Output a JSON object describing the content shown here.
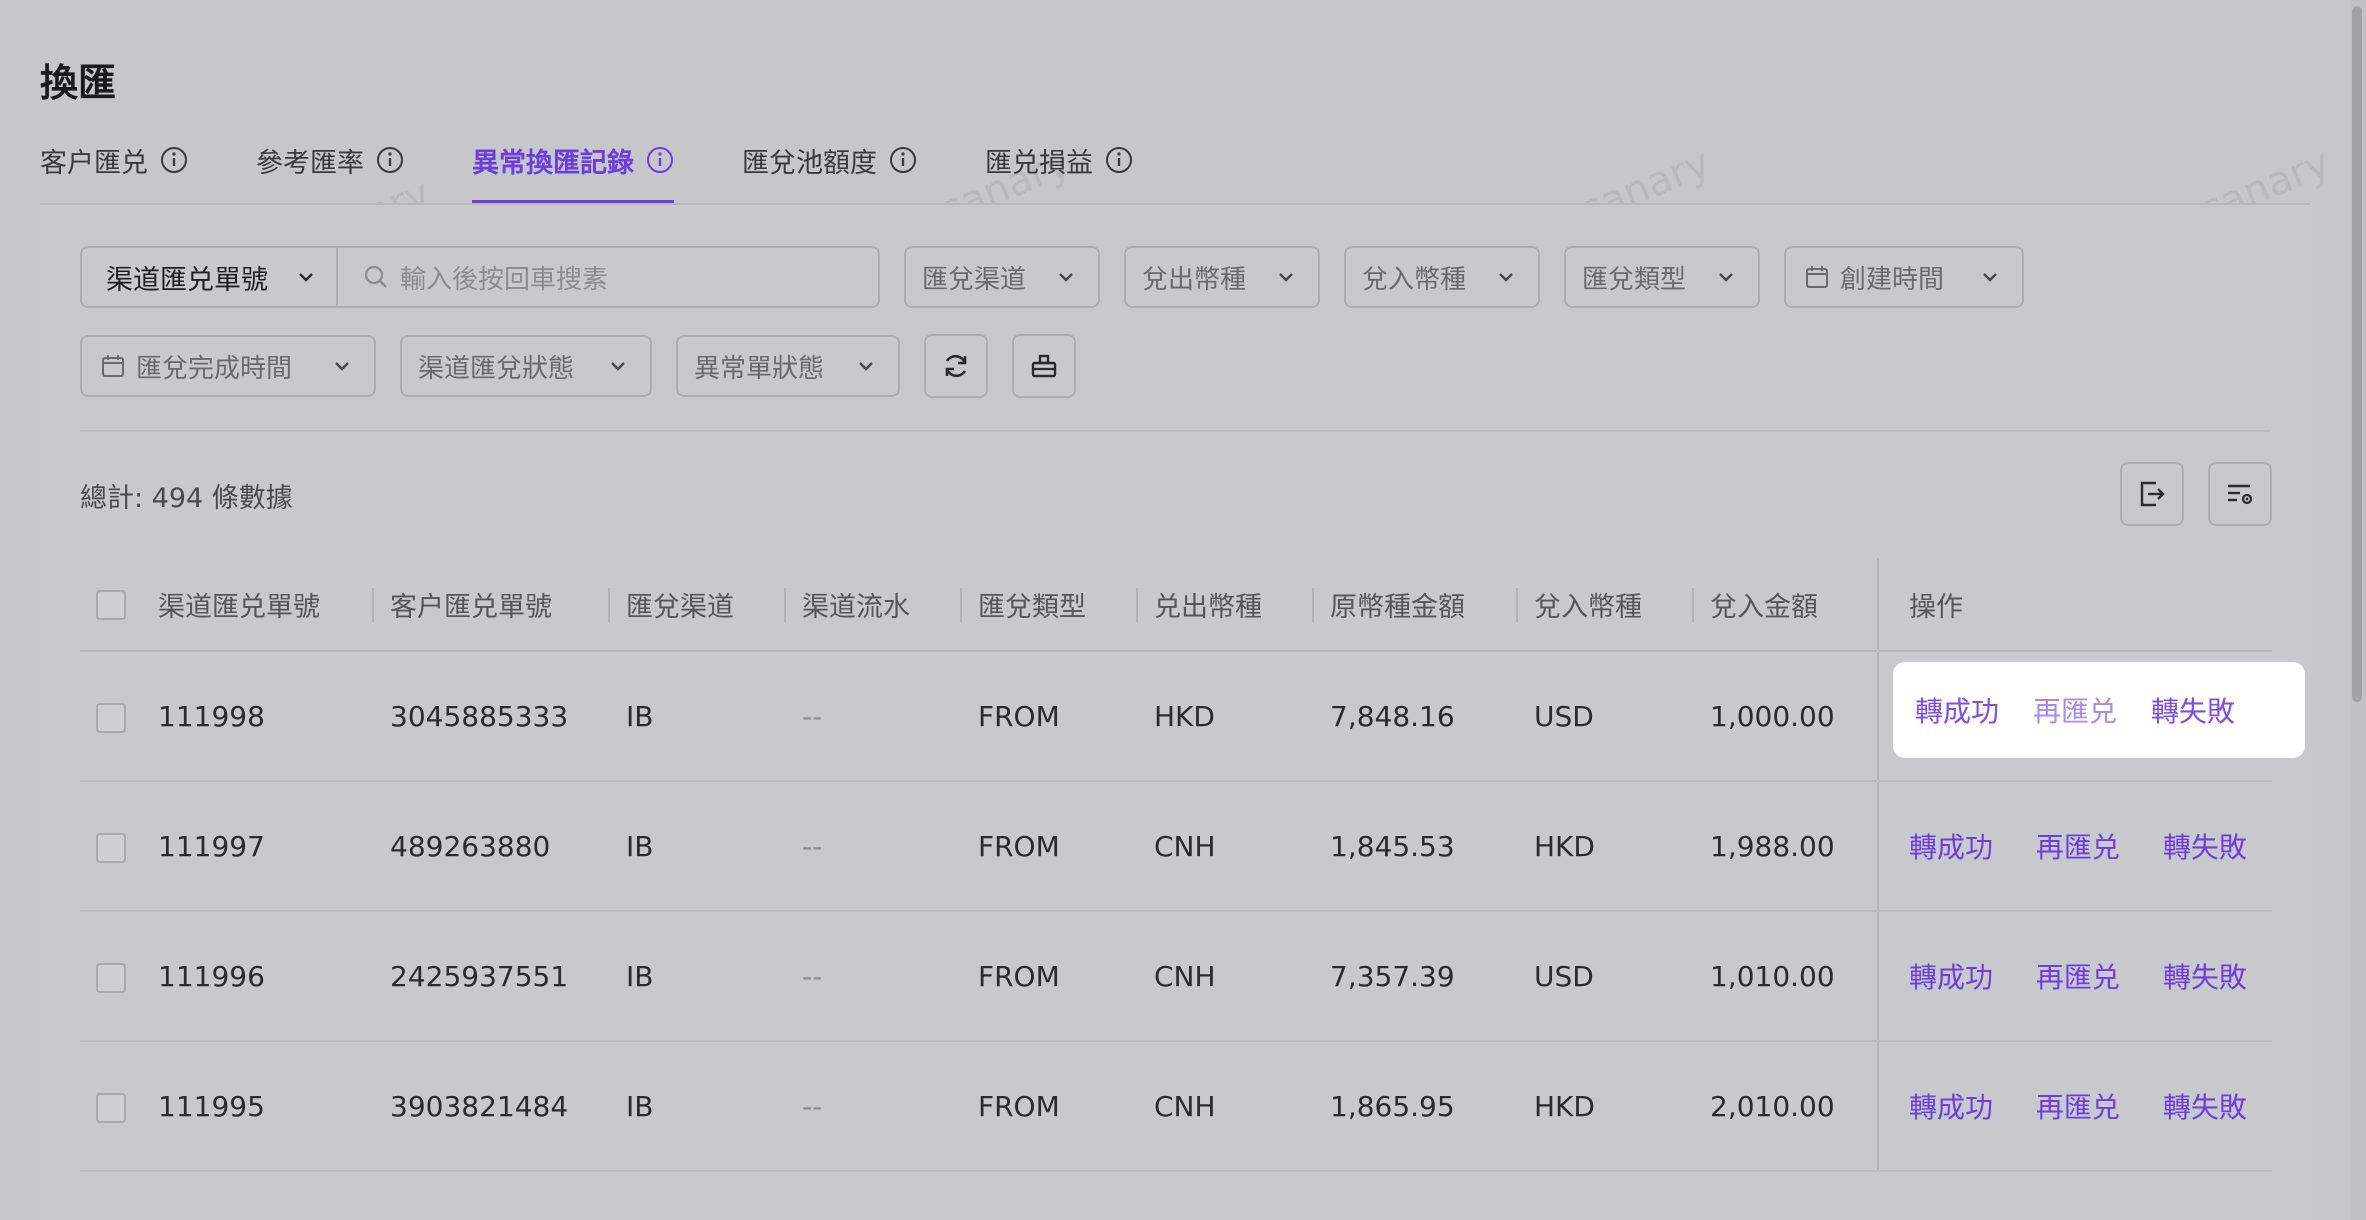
{
  "page": {
    "title": "換匯"
  },
  "tabs": [
    {
      "label": "客户匯兑",
      "active": false
    },
    {
      "label": "參考匯率",
      "active": false
    },
    {
      "label": "異常換匯記錄",
      "active": true
    },
    {
      "label": "匯兌池額度",
      "active": false
    },
    {
      "label": "匯兑損益",
      "active": false
    }
  ],
  "filters": {
    "search_field": "渠道匯兑單號",
    "search_placeholder": "輸入後按回車搜素",
    "channel": "匯兌渠道",
    "out_currency": "兌出幣種",
    "in_currency": "兌入幣種",
    "exchange_type": "匯兌類型",
    "created_time": "創建時間",
    "completed_time": "匯兌完成時間",
    "channel_status": "渠道匯兌狀態",
    "exception_status": "異常單狀態"
  },
  "summary": {
    "total": "總計: 494 條數據"
  },
  "table": {
    "columns": [
      "渠道匯兑單號",
      "客户匯兑單號",
      "匯兌渠道",
      "渠道流水",
      "匯兌類型",
      "兑出幣種",
      "原幣種金額",
      "兌入幣種",
      "兌入金額",
      "操作"
    ],
    "rows": [
      {
        "channel_no": "111998",
        "customer_no": "3045885333",
        "channel": "IB",
        "serial": "--",
        "type": "FROM",
        "out_ccy": "HKD",
        "orig_amount": "7,848.16",
        "in_ccy": "USD",
        "in_amount": "1,000.00"
      },
      {
        "channel_no": "111997",
        "customer_no": "489263880",
        "channel": "IB",
        "serial": "--",
        "type": "FROM",
        "out_ccy": "CNH",
        "orig_amount": "1,845.53",
        "in_ccy": "HKD",
        "in_amount": "1,988.00"
      },
      {
        "channel_no": "111996",
        "customer_no": "2425937551",
        "channel": "IB",
        "serial": "--",
        "type": "FROM",
        "out_ccy": "CNH",
        "orig_amount": "7,357.39",
        "in_ccy": "USD",
        "in_amount": "1,010.00"
      },
      {
        "channel_no": "111995",
        "customer_no": "3903821484",
        "channel": "IB",
        "serial": "--",
        "type": "FROM",
        "out_ccy": "CNH",
        "orig_amount": "1,865.95",
        "in_ccy": "HKD",
        "in_amount": "2,010.00"
      }
    ],
    "actions": {
      "success": "轉成功",
      "retry": "再匯兑",
      "fail": "轉失敗"
    }
  },
  "watermark": "扳机(豬明明) canary",
  "colors": {
    "accent": "#6a3fe0",
    "background": "#c7c7c9",
    "highlight": "#ffffff"
  }
}
